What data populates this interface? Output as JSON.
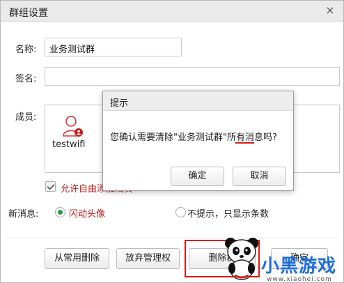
{
  "window": {
    "title": "群组设置",
    "close_glyph": "×"
  },
  "form": {
    "name_label": "名称:",
    "name_value": "业务测试群",
    "sign_label": "签名:",
    "sign_value": "",
    "members_label": "成员:",
    "members": [
      {
        "name": "testwifi",
        "is_admin": true
      }
    ],
    "allow_text": "允许自由添加成员"
  },
  "new_message": {
    "label": "新消息:",
    "options": [
      {
        "label": "闪动头像",
        "selected": true
      },
      {
        "label": "不提示，只显示条数",
        "selected": false
      }
    ]
  },
  "footer": {
    "remove_common": "从常用删除",
    "give_up_admin": "放弃管理权",
    "delete_group": "删除群",
    "extra_button": "确定"
  },
  "dialog": {
    "title": "提示",
    "message": "您确认需要清除\"业务测试群\"所有消息吗?",
    "ok": "确定",
    "cancel": "取消"
  },
  "watermark": {
    "logo_text": "小黑游戏",
    "url": "www.xiaohei.com"
  },
  "colors": {
    "accent_red": "#e01515",
    "radio_green": "#2d9b3f",
    "title_bg": "#eaeaea"
  }
}
